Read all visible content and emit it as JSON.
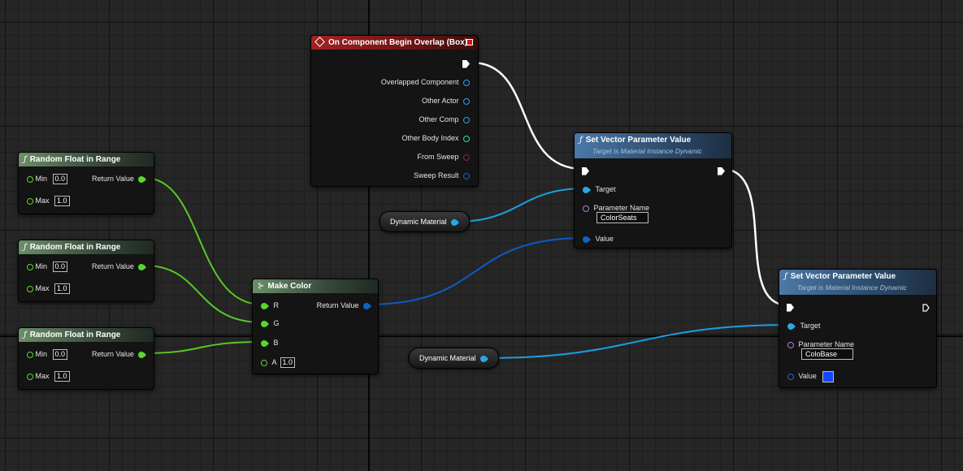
{
  "colors": {
    "exec_wire": "#ffffff",
    "float_wire": "#58c927",
    "object_wire": "#1aa0e0",
    "struct_wire": "#0c5cc4",
    "color_value": "#1248ff"
  },
  "random_float_nodes": [
    {
      "title": "Random Float in Range",
      "min_label": "Min",
      "min_value": "0.0",
      "max_label": "Max",
      "max_value": "1.0",
      "return_label": "Return Value"
    },
    {
      "title": "Random Float in Range",
      "min_label": "Min",
      "min_value": "0.0",
      "max_label": "Max",
      "max_value": "1.0",
      "return_label": "Return Value"
    },
    {
      "title": "Random Float in Range",
      "min_label": "Min",
      "min_value": "0.0",
      "max_label": "Max",
      "max_value": "1.0",
      "return_label": "Return Value"
    }
  ],
  "event_node": {
    "title": "On Component Begin Overlap (Box)",
    "pins": [
      "Overlapped Component",
      "Other Actor",
      "Other Comp",
      "Other Body Index",
      "From Sweep",
      "Sweep Result"
    ]
  },
  "make_color_node": {
    "title": "Make Color",
    "r_label": "R",
    "g_label": "G",
    "b_label": "B",
    "a_label": "A",
    "a_value": "1.0",
    "return_label": "Return Value"
  },
  "dynamic_material_1": {
    "label": "Dynamic Material"
  },
  "dynamic_material_2": {
    "label": "Dynamic Material"
  },
  "set_vector_1": {
    "title": "Set Vector Parameter Value",
    "subtitle": "Target is Material Instance Dynamic",
    "target_label": "Target",
    "param_label": "Parameter Name",
    "param_value": "ColorSeats",
    "value_label": "Value"
  },
  "set_vector_2": {
    "title": "Set Vector Parameter Value",
    "subtitle": "Target is Material Instance Dynamic",
    "target_label": "Target",
    "param_label": "Parameter Name",
    "param_value": "ColoBase",
    "value_label": "Value"
  }
}
